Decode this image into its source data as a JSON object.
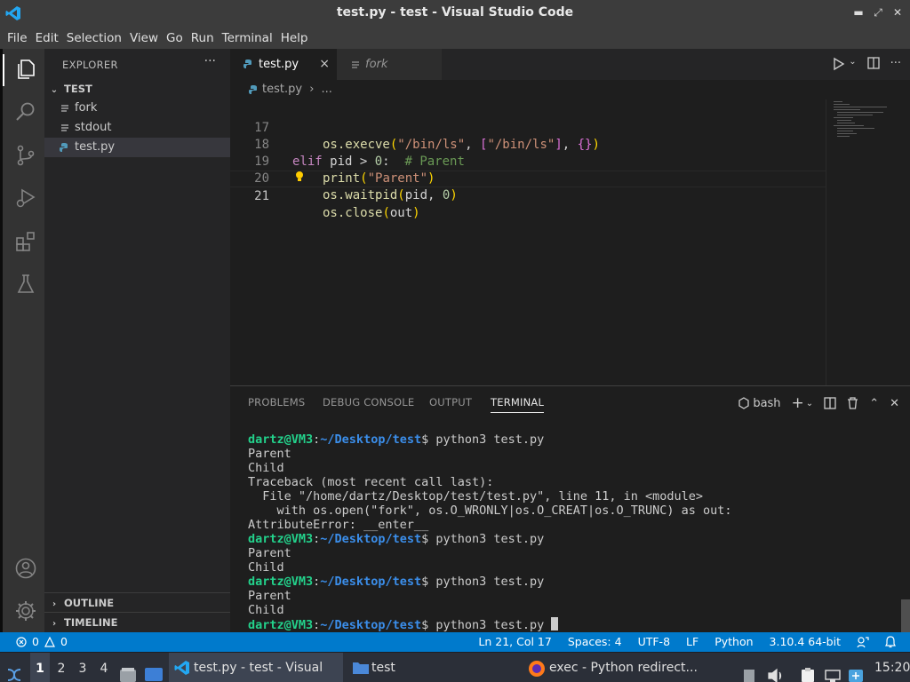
{
  "window": {
    "title": "test.py - test - Visual Studio Code"
  },
  "menu": [
    "File",
    "Edit",
    "Selection",
    "View",
    "Go",
    "Run",
    "Terminal",
    "Help"
  ],
  "sidebar": {
    "header": "EXPLORER",
    "more": "···",
    "folder": "TEST",
    "files": [
      {
        "name": "fork",
        "icon": "lines-icon"
      },
      {
        "name": "stdout",
        "icon": "lines-icon"
      },
      {
        "name": "test.py",
        "icon": "python-icon"
      }
    ],
    "outline": "OUTLINE",
    "timeline": "TIMELINE"
  },
  "tabs": [
    {
      "label": "test.py",
      "close": "×"
    },
    {
      "label": "fork"
    }
  ],
  "breadcrumb": {
    "file": "test.py",
    "rest": "..."
  },
  "editor": {
    "lines": [
      {
        "num": "17"
      },
      {
        "num": "18"
      },
      {
        "num": "19"
      },
      {
        "num": "20"
      },
      {
        "num": "21"
      }
    ],
    "code": {
      "l17_fn": "os.execve",
      "l17_s1": "\"/bin/ls\"",
      "l17_s2": "\"/bin/ls\"",
      "l18_kw": "elif",
      "l18_rest": " pid > ",
      "l18_num": "0",
      "l18_colon": ":  ",
      "l18_cm": "# Parent",
      "l19_fn": "print",
      "l19_str": "\"Parent\"",
      "l20_fn": "os.waitpid",
      "l20_args": "pid, ",
      "l20_num": "0",
      "l21_fn": "os.close",
      "l21_arg": "out"
    }
  },
  "panel": {
    "tabs": [
      "PROBLEMS",
      "DEBUG CONSOLE",
      "OUTPUT",
      "TERMINAL"
    ],
    "shell": "bash",
    "terminal": {
      "user": "dartz@VM3",
      "path": "~/Desktop/test",
      "cmd": "$ python3 test.py",
      "out_parent": "Parent",
      "out_child": "Child",
      "tb1": "Traceback (most recent call last):",
      "tb2": "  File \"/home/dartz/Desktop/test/test.py\", line 11, in <module>",
      "tb3": "    with os.open(\"fork\", os.O_WRONLY|os.O_CREAT|os.O_TRUNC) as out:",
      "tb4": "AttributeError: __enter__"
    }
  },
  "status": {
    "errors": "0",
    "warnings": "0",
    "position": "Ln 21, Col 17",
    "spaces": "Spaces: 4",
    "encoding": "UTF-8",
    "eol": "LF",
    "language": "Python",
    "interpreter": "3.10.4 64-bit"
  },
  "taskbar": {
    "workspaces": [
      "1",
      "2",
      "3",
      "4"
    ],
    "task_vscode": "test.py - test - Visual S...",
    "task_folder": "test",
    "task_firefox": "exec - Python redirect...",
    "clock": "15:20"
  },
  "colors": {
    "accent": "#007acc",
    "terminal_user": "#23d18b",
    "terminal_path": "#3b8eea"
  }
}
